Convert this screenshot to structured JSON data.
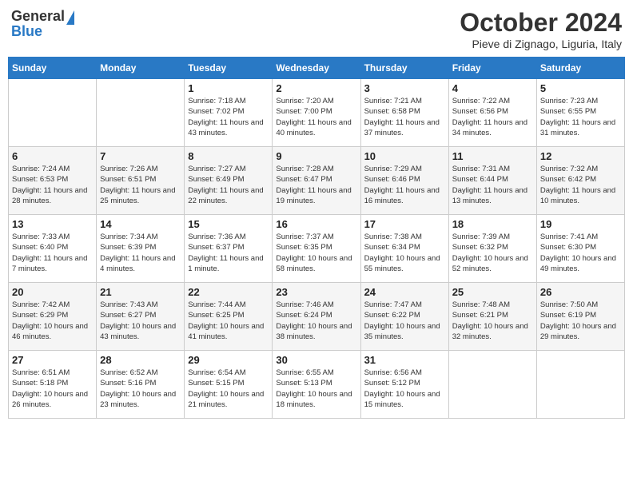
{
  "logo": {
    "general": "General",
    "blue": "Blue"
  },
  "header": {
    "month": "October 2024",
    "location": "Pieve di Zignago, Liguria, Italy"
  },
  "weekdays": [
    "Sunday",
    "Monday",
    "Tuesday",
    "Wednesday",
    "Thursday",
    "Friday",
    "Saturday"
  ],
  "weeks": [
    [
      {
        "day": "",
        "info": ""
      },
      {
        "day": "",
        "info": ""
      },
      {
        "day": "1",
        "info": "Sunrise: 7:18 AM\nSunset: 7:02 PM\nDaylight: 11 hours and 43 minutes."
      },
      {
        "day": "2",
        "info": "Sunrise: 7:20 AM\nSunset: 7:00 PM\nDaylight: 11 hours and 40 minutes."
      },
      {
        "day": "3",
        "info": "Sunrise: 7:21 AM\nSunset: 6:58 PM\nDaylight: 11 hours and 37 minutes."
      },
      {
        "day": "4",
        "info": "Sunrise: 7:22 AM\nSunset: 6:56 PM\nDaylight: 11 hours and 34 minutes."
      },
      {
        "day": "5",
        "info": "Sunrise: 7:23 AM\nSunset: 6:55 PM\nDaylight: 11 hours and 31 minutes."
      }
    ],
    [
      {
        "day": "6",
        "info": "Sunrise: 7:24 AM\nSunset: 6:53 PM\nDaylight: 11 hours and 28 minutes."
      },
      {
        "day": "7",
        "info": "Sunrise: 7:26 AM\nSunset: 6:51 PM\nDaylight: 11 hours and 25 minutes."
      },
      {
        "day": "8",
        "info": "Sunrise: 7:27 AM\nSunset: 6:49 PM\nDaylight: 11 hours and 22 minutes."
      },
      {
        "day": "9",
        "info": "Sunrise: 7:28 AM\nSunset: 6:47 PM\nDaylight: 11 hours and 19 minutes."
      },
      {
        "day": "10",
        "info": "Sunrise: 7:29 AM\nSunset: 6:46 PM\nDaylight: 11 hours and 16 minutes."
      },
      {
        "day": "11",
        "info": "Sunrise: 7:31 AM\nSunset: 6:44 PM\nDaylight: 11 hours and 13 minutes."
      },
      {
        "day": "12",
        "info": "Sunrise: 7:32 AM\nSunset: 6:42 PM\nDaylight: 11 hours and 10 minutes."
      }
    ],
    [
      {
        "day": "13",
        "info": "Sunrise: 7:33 AM\nSunset: 6:40 PM\nDaylight: 11 hours and 7 minutes."
      },
      {
        "day": "14",
        "info": "Sunrise: 7:34 AM\nSunset: 6:39 PM\nDaylight: 11 hours and 4 minutes."
      },
      {
        "day": "15",
        "info": "Sunrise: 7:36 AM\nSunset: 6:37 PM\nDaylight: 11 hours and 1 minute."
      },
      {
        "day": "16",
        "info": "Sunrise: 7:37 AM\nSunset: 6:35 PM\nDaylight: 10 hours and 58 minutes."
      },
      {
        "day": "17",
        "info": "Sunrise: 7:38 AM\nSunset: 6:34 PM\nDaylight: 10 hours and 55 minutes."
      },
      {
        "day": "18",
        "info": "Sunrise: 7:39 AM\nSunset: 6:32 PM\nDaylight: 10 hours and 52 minutes."
      },
      {
        "day": "19",
        "info": "Sunrise: 7:41 AM\nSunset: 6:30 PM\nDaylight: 10 hours and 49 minutes."
      }
    ],
    [
      {
        "day": "20",
        "info": "Sunrise: 7:42 AM\nSunset: 6:29 PM\nDaylight: 10 hours and 46 minutes."
      },
      {
        "day": "21",
        "info": "Sunrise: 7:43 AM\nSunset: 6:27 PM\nDaylight: 10 hours and 43 minutes."
      },
      {
        "day": "22",
        "info": "Sunrise: 7:44 AM\nSunset: 6:25 PM\nDaylight: 10 hours and 41 minutes."
      },
      {
        "day": "23",
        "info": "Sunrise: 7:46 AM\nSunset: 6:24 PM\nDaylight: 10 hours and 38 minutes."
      },
      {
        "day": "24",
        "info": "Sunrise: 7:47 AM\nSunset: 6:22 PM\nDaylight: 10 hours and 35 minutes."
      },
      {
        "day": "25",
        "info": "Sunrise: 7:48 AM\nSunset: 6:21 PM\nDaylight: 10 hours and 32 minutes."
      },
      {
        "day": "26",
        "info": "Sunrise: 7:50 AM\nSunset: 6:19 PM\nDaylight: 10 hours and 29 minutes."
      }
    ],
    [
      {
        "day": "27",
        "info": "Sunrise: 6:51 AM\nSunset: 5:18 PM\nDaylight: 10 hours and 26 minutes."
      },
      {
        "day": "28",
        "info": "Sunrise: 6:52 AM\nSunset: 5:16 PM\nDaylight: 10 hours and 23 minutes."
      },
      {
        "day": "29",
        "info": "Sunrise: 6:54 AM\nSunset: 5:15 PM\nDaylight: 10 hours and 21 minutes."
      },
      {
        "day": "30",
        "info": "Sunrise: 6:55 AM\nSunset: 5:13 PM\nDaylight: 10 hours and 18 minutes."
      },
      {
        "day": "31",
        "info": "Sunrise: 6:56 AM\nSunset: 5:12 PM\nDaylight: 10 hours and 15 minutes."
      },
      {
        "day": "",
        "info": ""
      },
      {
        "day": "",
        "info": ""
      }
    ]
  ]
}
